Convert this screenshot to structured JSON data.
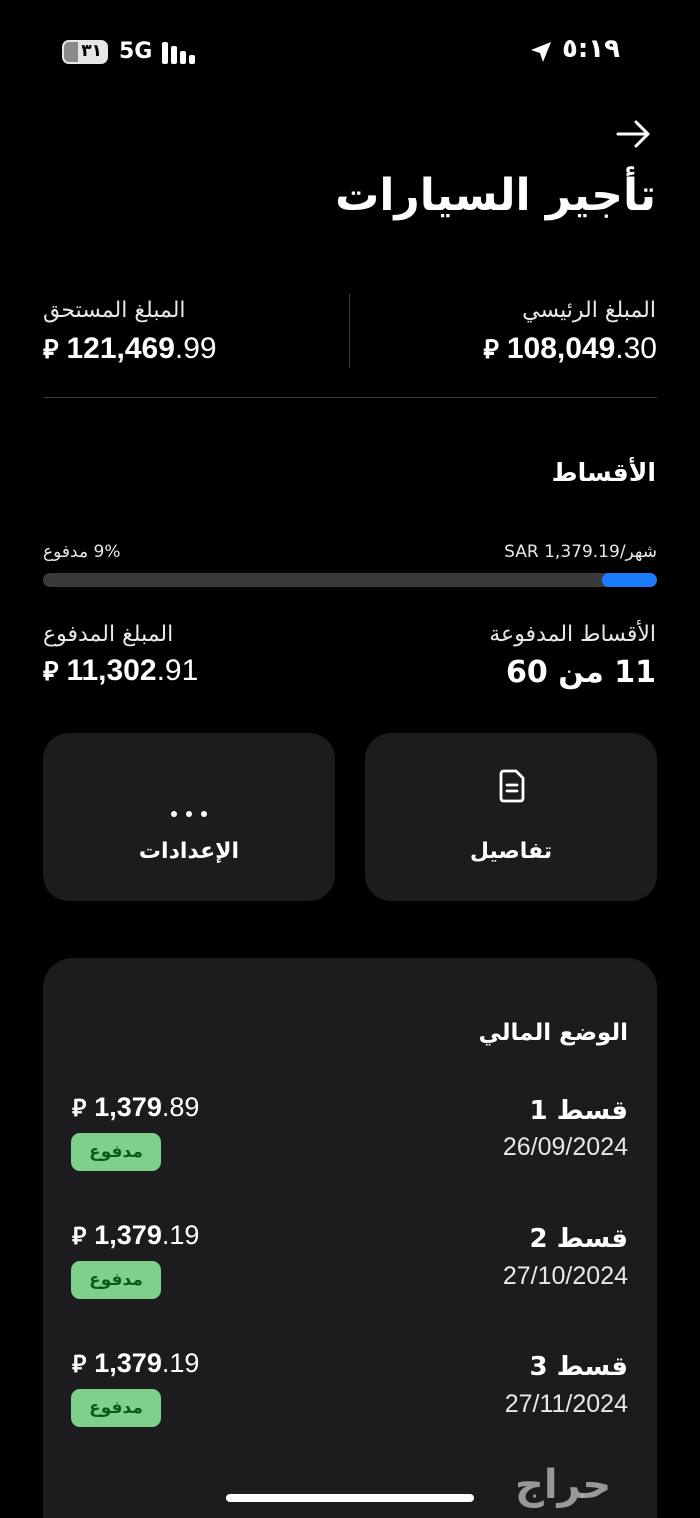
{
  "status_bar": {
    "battery": "٣١",
    "network": "5G",
    "time": "٥:١٩"
  },
  "header": {
    "back_icon": "arrow-right-icon",
    "title": "تأجير السيارات"
  },
  "summary": {
    "principal_label": "المبلغ الرئيسي",
    "principal_int": "108,049",
    "principal_dec": ".30",
    "due_label": "المبلغ المستحق",
    "due_int": "121,469",
    "due_dec": ".99",
    "currency_symbol": "⃁"
  },
  "installments": {
    "heading": "الأقساط",
    "monthly_text": "شهر/SAR 1,379.19",
    "paid_percent_text": "9% مدفوع",
    "progress_fraction": 0.09,
    "paid_installments_label": "الأقساط المدفوعة",
    "paid_installments_value": "11 من 60",
    "paid_amount_label": "المبلغ المدفوع",
    "paid_amount_int": "11,302",
    "paid_amount_dec": ".91",
    "progress_color": "#1c7cff"
  },
  "actions": {
    "details_label": "تفاصيل",
    "details_icon": "document-icon",
    "settings_label": "الإعدادات",
    "settings_icon": "more-dots-icon"
  },
  "financial": {
    "title": "الوضع المالي",
    "items": [
      {
        "name": "قسط 1",
        "date": "26/09/2024",
        "amount_int": "1,379",
        "amount_dec": ".89",
        "status": "مدفوع"
      },
      {
        "name": "قسط 2",
        "date": "27/10/2024",
        "amount_int": "1,379",
        "amount_dec": ".19",
        "status": "مدفوع"
      },
      {
        "name": "قسط 3",
        "date": "27/11/2024",
        "amount_int": "1,379",
        "amount_dec": ".19",
        "status": "مدفوع"
      }
    ],
    "badge_color": "#7fd08a"
  },
  "watermark": "حراج"
}
